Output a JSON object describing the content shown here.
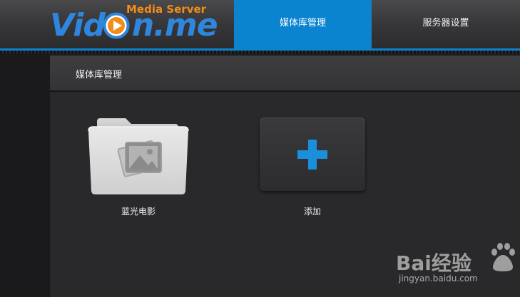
{
  "app": {
    "logo": {
      "wordmark_prefix": "Vid",
      "wordmark_suffix": "n.me",
      "subtitle": "Media Server"
    },
    "colors": {
      "accent": "#0b84cf",
      "logo_blue": "#2f86de",
      "logo_orange": "#f28c1a",
      "plus_blue": "#1a8fdc"
    }
  },
  "nav": {
    "tabs": [
      {
        "label": "媒体库管理",
        "active": true
      },
      {
        "label": "服务器设置",
        "active": false
      }
    ]
  },
  "main": {
    "section_title": "媒体库管理",
    "items": [
      {
        "label": "蓝光电影",
        "icon": "photo-folder-icon"
      },
      {
        "label": "添加",
        "icon": "plus-icon"
      }
    ]
  },
  "watermark": {
    "brand": "Bai经验",
    "url": "jingyan.baidu.com",
    "icon": "baidu-paw-icon"
  }
}
